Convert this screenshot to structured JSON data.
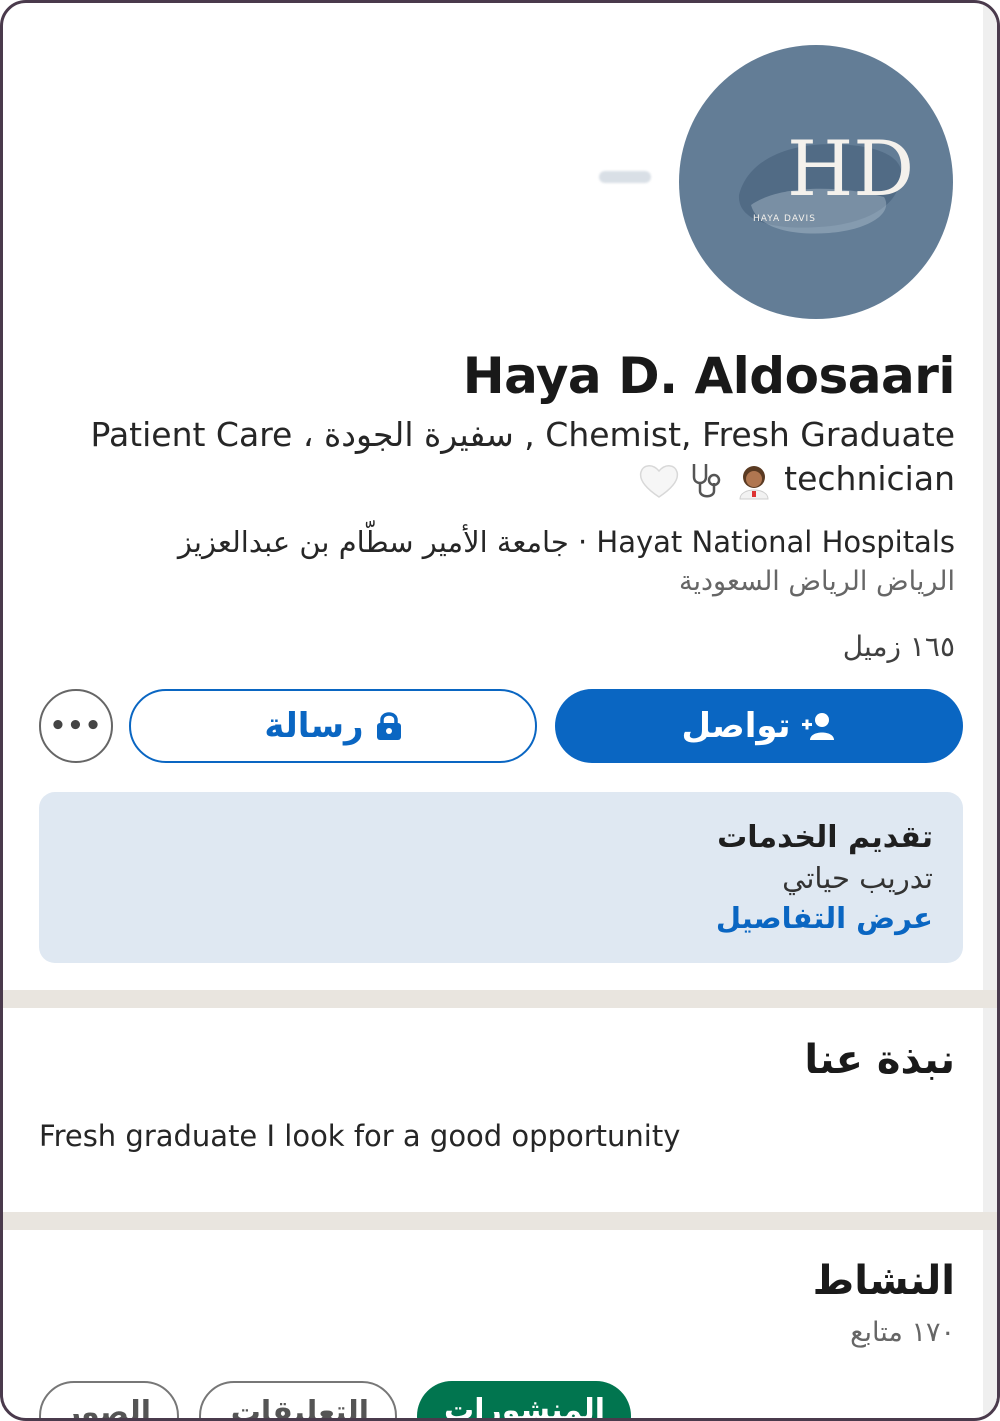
{
  "profile": {
    "avatar_monogram": "HD",
    "avatar_caption": "HAYA DAVIS",
    "name": "Haya D. Aldosaari",
    "headline_line1": "Chemist, Fresh Graduate , سفيرة الجودة ، Patient Care",
    "headline_line2": "technician",
    "headline_emojis": [
      "woman-health-worker-emoji",
      "stethoscope-emoji",
      "white-heart-emoji"
    ],
    "company": "Hayat National Hospitals · جامعة الأمير سطّام بن عبدالعزيز",
    "location": "الرياض الرياض السعودية",
    "connections": "١٦٥ زميل"
  },
  "actions": {
    "connect_label": "تواصل",
    "message_label": "رسالة",
    "more_label": "•••"
  },
  "services": {
    "title": "تقديم الخدمات",
    "subtitle": "تدريب حياتي",
    "link": "عرض التفاصيل"
  },
  "about": {
    "title": "نبذة عنا",
    "text": "Fresh graduate I look for a good opportunity"
  },
  "activity": {
    "title": "النشاط",
    "followers": "١٧٠ متابع",
    "tabs": [
      "المنشورات",
      "التعليقات",
      "الصور"
    ]
  },
  "colors": {
    "primary": "#0a66c2",
    "active_tab": "#01754f",
    "services_bg": "#dfe8f2",
    "avatar_bg": "#637d96"
  }
}
